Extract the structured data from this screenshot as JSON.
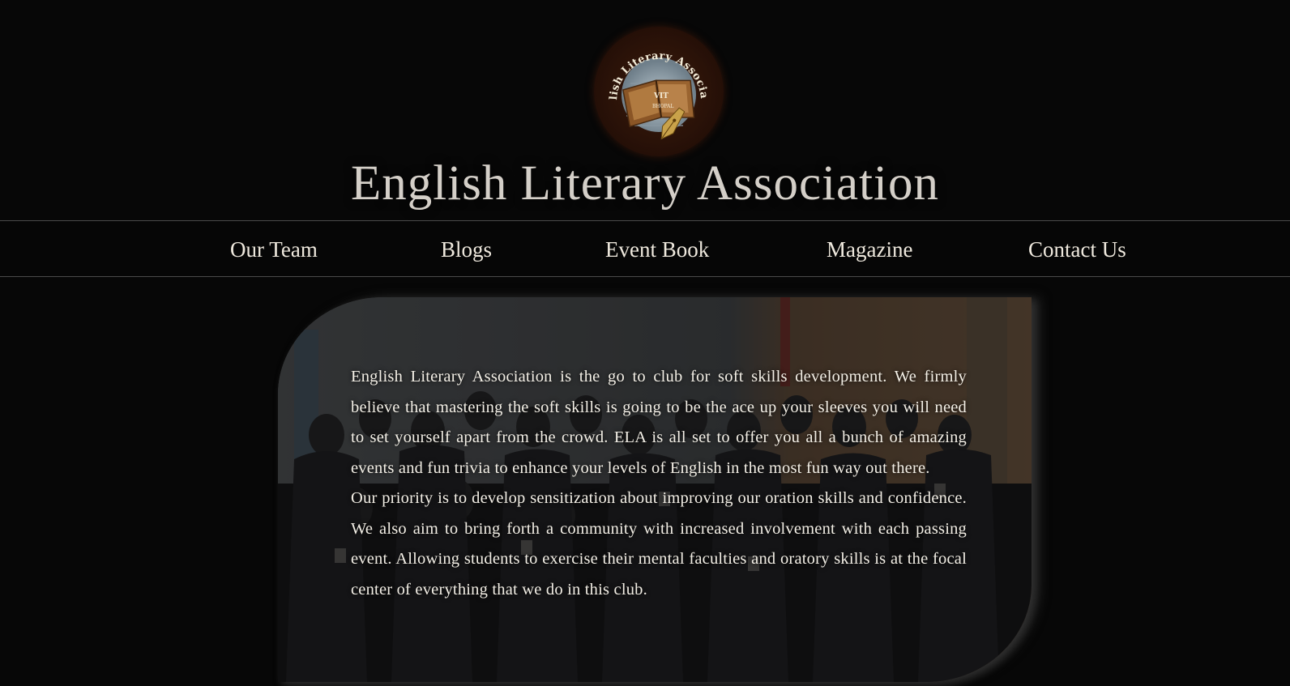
{
  "header": {
    "logo_text": "English Literary Association",
    "logo_book_text": "VIT",
    "logo_book_subtext": "BHOPAL",
    "title": "English Literary Association"
  },
  "nav": {
    "items": [
      {
        "label": "Our Team"
      },
      {
        "label": "Blogs"
      },
      {
        "label": "Event Book"
      },
      {
        "label": "Magazine"
      },
      {
        "label": "Contact Us"
      }
    ]
  },
  "hero": {
    "paragraph_1": "English Literary Association is the go to club for soft skills development. We firmly believe that mastering the soft skills is going to be the ace up your sleeves you will need to set yourself apart from the crowd. ELA is all set to offer you all a bunch of amazing events and fun trivia to enhance your levels of English in the most fun way out there.",
    "paragraph_2": "Our priority is to develop sensitization about improving our oration skills and confidence. We also aim to bring forth a community with increased involvement with each passing event. Allowing students to exercise their mental faculties and oratory skills is at the focal center of everything that we do in this club."
  },
  "colors": {
    "background": "#070707",
    "title": "#d4cfc8",
    "nav_text": "#efe9de",
    "divider": "#4a4a4a",
    "logo_ring": "#2a1208",
    "body_text": "#f3efe6"
  }
}
